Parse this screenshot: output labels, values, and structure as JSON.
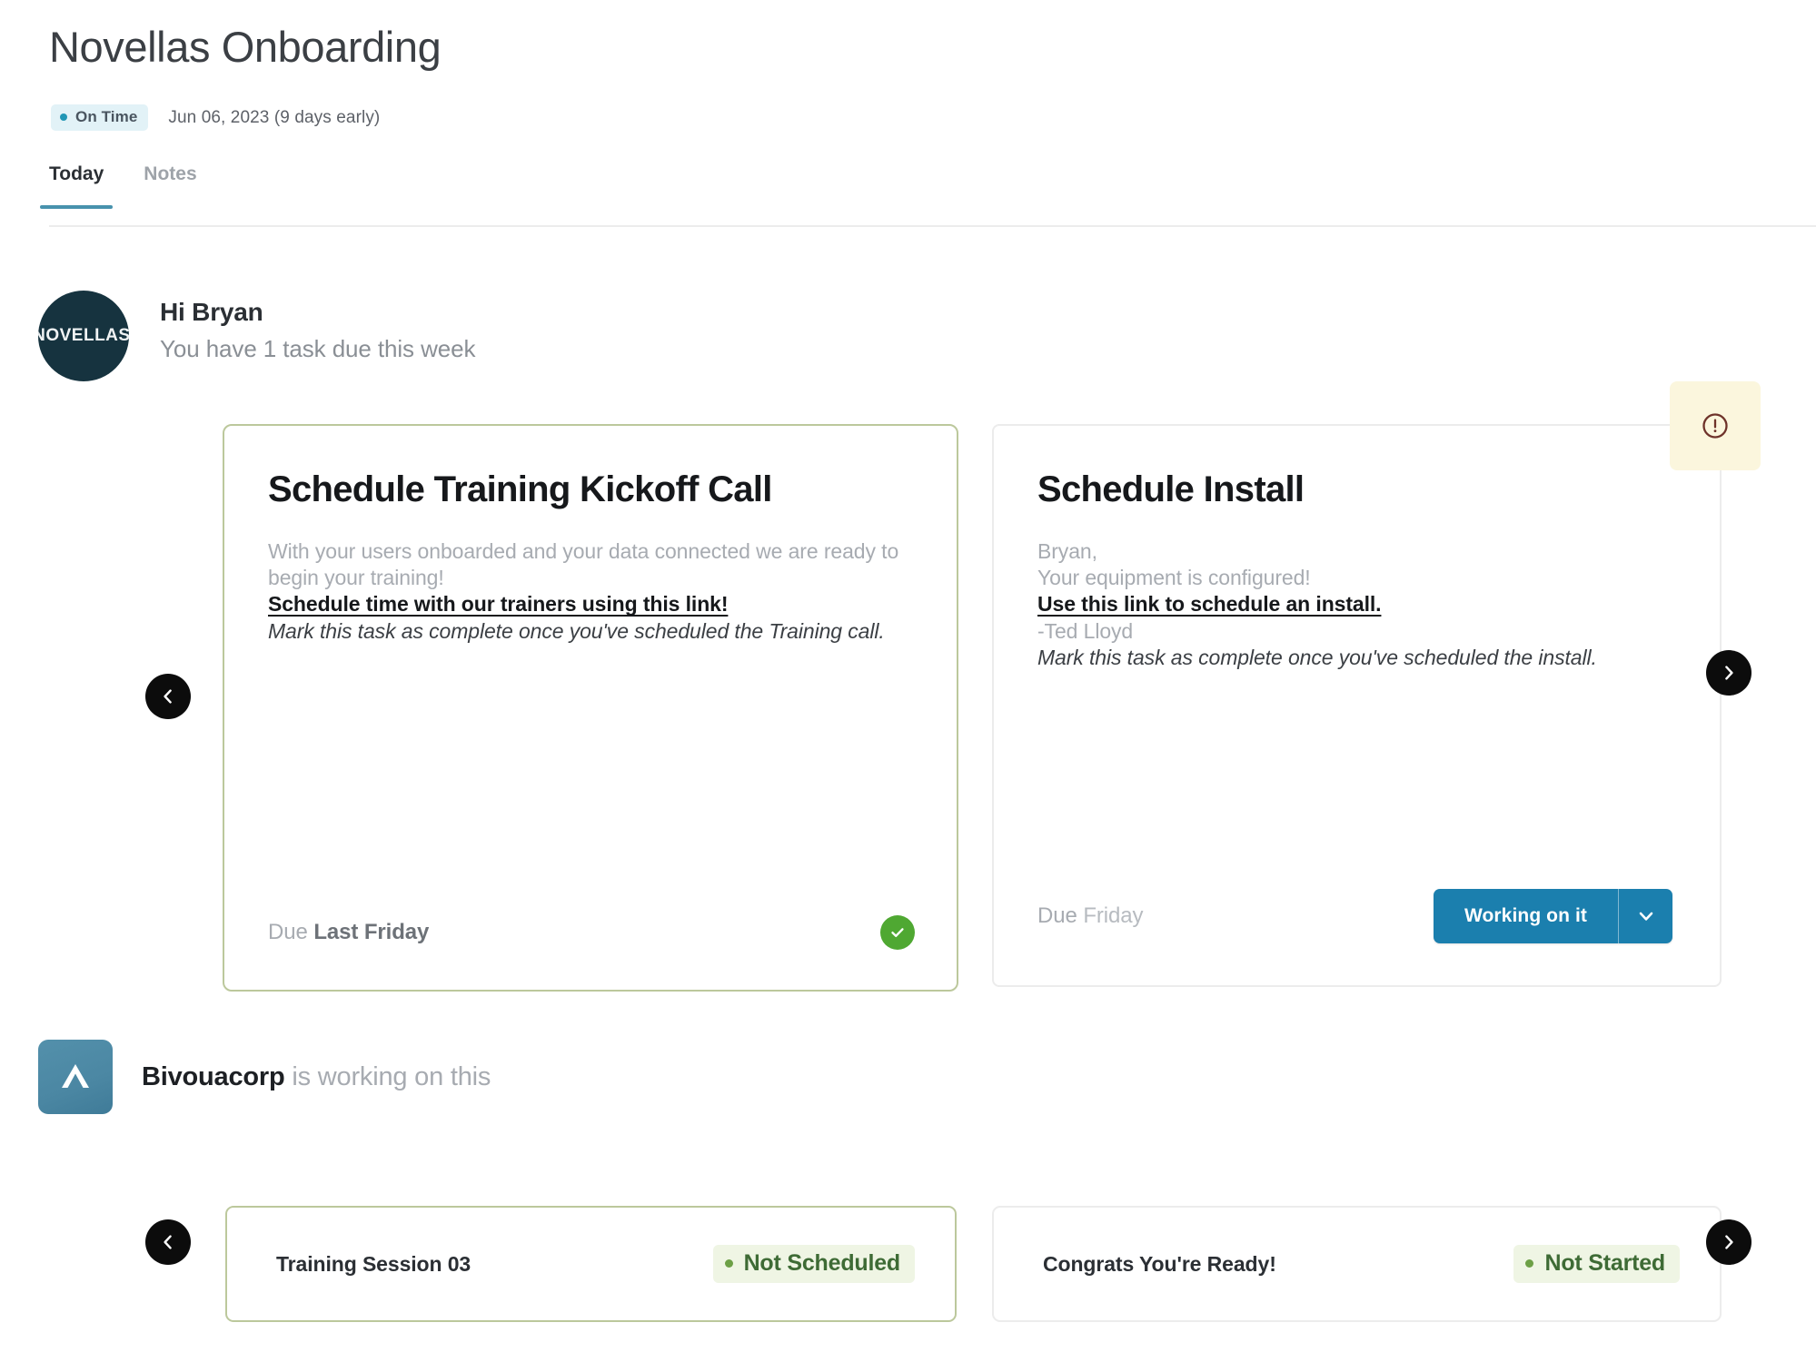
{
  "header": {
    "title": "Novellas Onboarding",
    "status_badge": "On Time",
    "date_text": "Jun 06, 2023 (9 days early)",
    "status_color": "#2196b5",
    "badge_bg": "#e2f2f7"
  },
  "tabs": [
    {
      "label": "Today",
      "active": true
    },
    {
      "label": "Notes",
      "active": false
    }
  ],
  "greeting": {
    "avatar_text": "NOVELLAS",
    "avatar_color": "#16333f",
    "title": "Hi Bryan",
    "subtitle": "You have 1 task due this week"
  },
  "task_cards": [
    {
      "title": "Schedule Training Kickoff Call",
      "body_muted": "With your users onboarded and your data connected we are ready to begin your training!",
      "body_link": "Schedule time with our trainers using this link!",
      "body_italic": "Mark this task as complete once you've scheduled the Training call.",
      "due_prefix": "Due",
      "due_value": "Last Friday",
      "action": "complete-check",
      "border_color": "#bcc89c"
    },
    {
      "title": "Schedule Install",
      "body_salutation": "Bryan,",
      "body_muted": "Your equipment is configured!",
      "body_link": "Use this link to schedule an install.",
      "body_signature": "-Ted Lloyd",
      "body_italic": "Mark this task as complete once you've scheduled the install.",
      "due_prefix": "Due",
      "due_value": "Friday",
      "status_button": "Working on it",
      "status_button_color": "#1b7fae",
      "warning_flag_color": "#fbf6dd",
      "border_color": "#ececec"
    }
  ],
  "carousel": {
    "prev_icon": "chevron-left-icon",
    "next_icon": "chevron-right-icon"
  },
  "org": {
    "name": "Bivouacorp",
    "suffix": "is working on this",
    "logo_color": "#4b87a3"
  },
  "mini_cards": [
    {
      "title": "Training Session 03",
      "status": "Not Scheduled",
      "status_color": "#3e6b35",
      "border_color": "#bcc89c"
    },
    {
      "title": "Congrats You're Ready!",
      "status": "Not Started",
      "status_color": "#3e6b35",
      "border_color": "#ececec"
    }
  ]
}
